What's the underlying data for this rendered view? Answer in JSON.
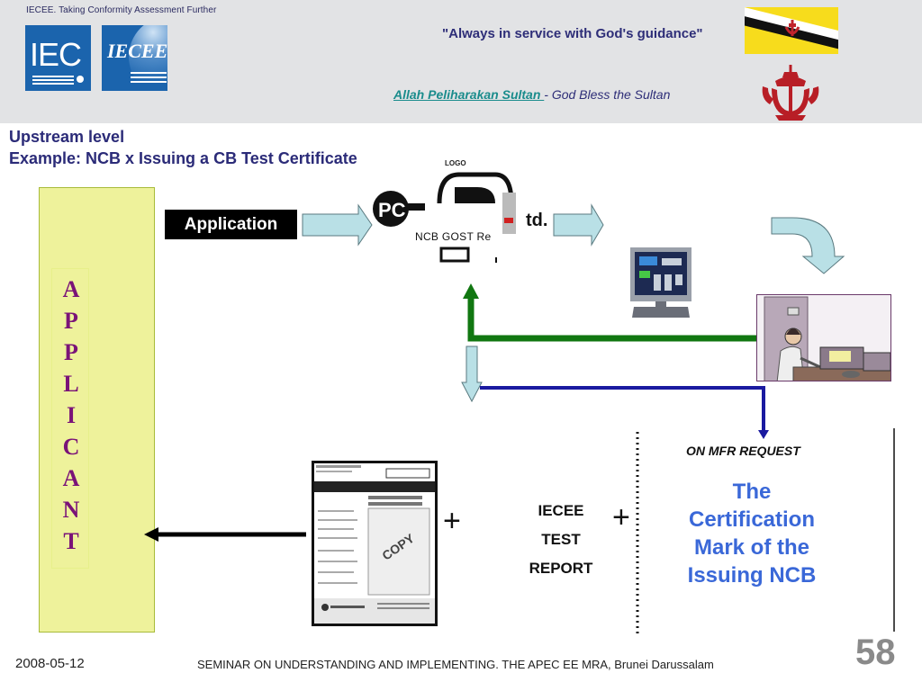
{
  "header": {
    "tagline": "IECEE. Taking Conformity Assessment Further",
    "iec_logo_text": "IEC",
    "iecee_logo_text": "IECEE",
    "motto": "\"Always in service with God's guidance\"",
    "blessing_link": "Allah Peliharakan Sultan ",
    "blessing_text": "- God Bless the Sultan"
  },
  "title": {
    "line1": "Upstream level",
    "line2": "Example: NCB x Issuing a CB Test Certificate"
  },
  "applicant": {
    "letters": [
      "A",
      "P",
      "P",
      "L",
      "I",
      "C",
      "A",
      "N",
      "T"
    ]
  },
  "flow": {
    "application_label": "Application",
    "ncb_logo_label": "LOGO",
    "ncb_caption": "NCB GOST Re",
    "ltd_text": "td.",
    "mfr_request": "ON MFR REQUEST",
    "plus_symbol": "+",
    "report_lines": [
      "IECEE",
      "TEST",
      "REPORT"
    ],
    "certification_mark_lines": [
      "The",
      "Certification",
      "Mark of the",
      "Issuing NCB"
    ]
  },
  "colors": {
    "header_bg": "#e2e3e5",
    "title_blue": "#2b2b78",
    "applicant_panel": "#eef29b",
    "applicant_text": "#7a1378",
    "green_line": "#117711",
    "blue_line": "#1a1aa0",
    "arrow_fill": "#b9e0e6",
    "cert_mark_blue": "#3a68d8"
  },
  "footer": {
    "date": "2008-05-12",
    "seminar": "SEMINAR ON UNDERSTANDING AND IMPLEMENTING. THE APEC EE MRA, Brunei Darussalam",
    "page_number": "58"
  }
}
